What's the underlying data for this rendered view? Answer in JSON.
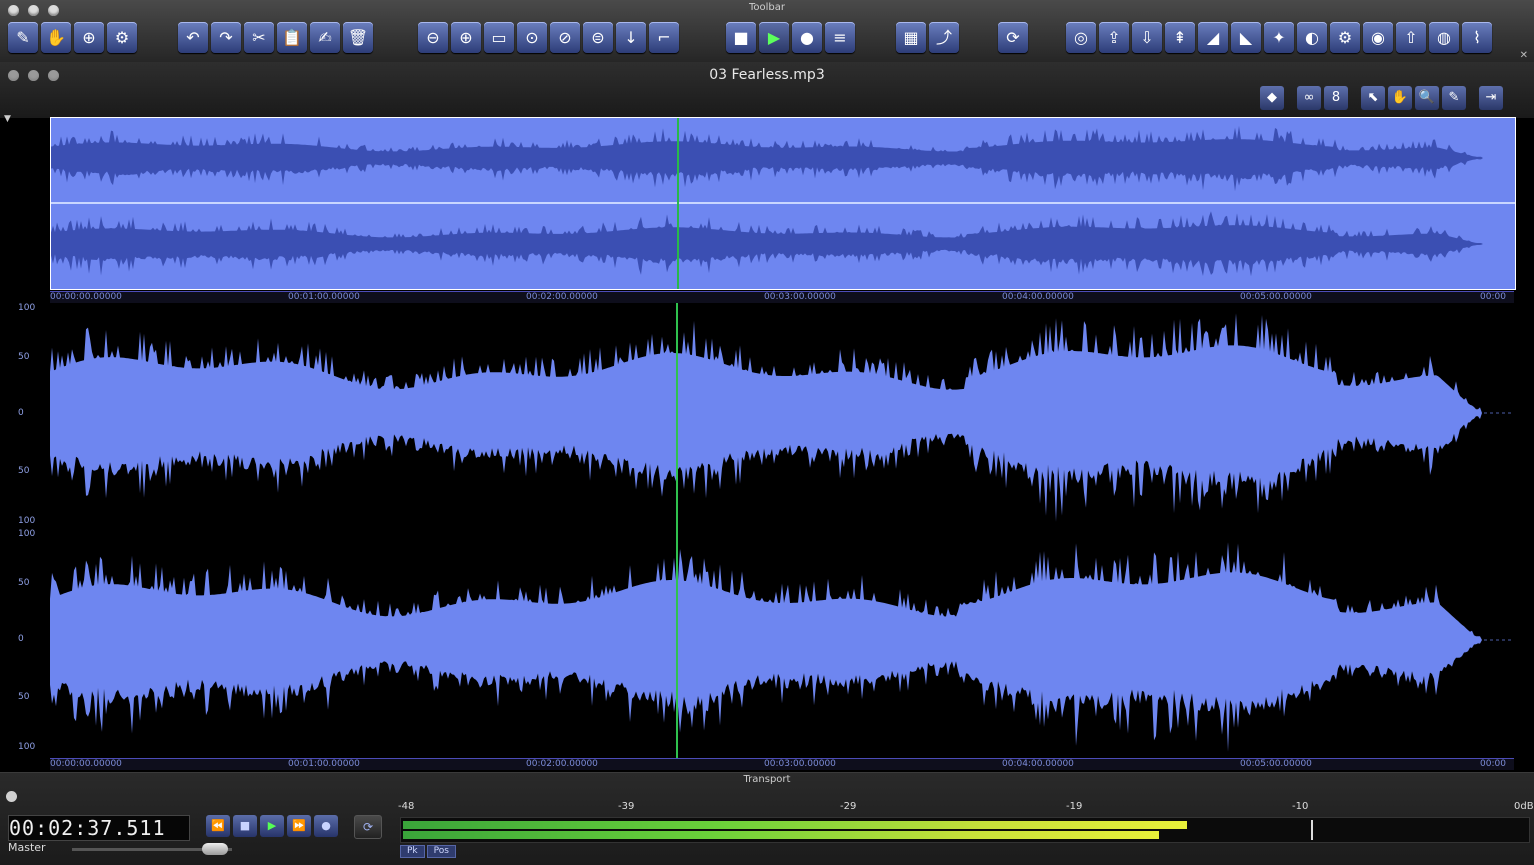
{
  "toolbar": {
    "title": "Toolbar",
    "groups": [
      [
        "✎",
        "✋",
        "⊕",
        "⚙"
      ],
      [
        "↶",
        "↷",
        "✂",
        "📋",
        "✍",
        "🗑"
      ],
      [
        "⊖",
        "⊕",
        "▭",
        "⊙",
        "⊘",
        "⊜",
        "↓",
        "⌐"
      ],
      [
        "■",
        "▶",
        "●",
        "≡"
      ],
      [
        "▦",
        "⤴"
      ],
      [
        "⟳"
      ],
      [
        "◎",
        "⇪",
        "⇩",
        "⇞",
        "◢",
        "◣",
        "✦",
        "◐",
        "⚙",
        "◉",
        "⇧",
        "◍",
        "⌇"
      ]
    ]
  },
  "document": {
    "title": "03 Fearless.mp3",
    "view_tools": [
      "◆",
      "∞",
      "8",
      "⬉",
      "✋",
      "🔍",
      "✎",
      "⇥"
    ]
  },
  "ruler": {
    "labels": [
      "00:00:00.00000",
      "00:01:00.00000",
      "00:02:00.00000",
      "00:03:00.00000",
      "00:04:00.00000",
      "00:05:00.00000",
      "00:00"
    ]
  },
  "amplitude": {
    "labels": [
      "100",
      "50",
      "0",
      "50",
      "100",
      "100",
      "50",
      "0",
      "50",
      "100"
    ]
  },
  "transport": {
    "title": "Transport",
    "timecode": "00:02:37.511",
    "master_label": "Master",
    "buttons": [
      "⏪",
      "■",
      "▶",
      "⏩",
      "●"
    ],
    "loop": "⟳",
    "meter_scale": [
      "-48",
      "-39",
      "-29",
      "-19",
      "-10",
      "0dB"
    ],
    "meter_tabs": [
      "Pk",
      "Pos"
    ]
  },
  "colors": {
    "waveform_fill": "#6e86f0",
    "playhead": "#2fc24e",
    "accent": "#3f52a0"
  }
}
